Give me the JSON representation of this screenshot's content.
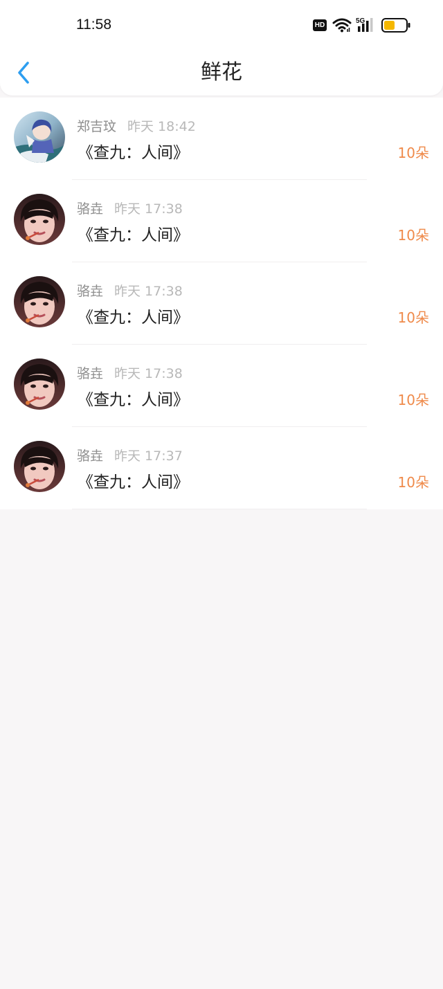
{
  "status_bar": {
    "time": "11:58",
    "hd_label": "HD",
    "network_label": "5G",
    "battery_level": 0.5,
    "battery_color": "#f5b800",
    "icons": [
      "hd-icon",
      "wifi-icon",
      "signal-icon",
      "battery-icon"
    ]
  },
  "header": {
    "title": "鲜花",
    "back_icon": "chevron-left-icon",
    "accent_color": "#2d9ef0"
  },
  "records": [
    {
      "name": "郑吉玟",
      "time": "昨天 18:42",
      "work": "《查九：人间》",
      "amount": "10朵",
      "avatar": "anime-avatar"
    },
    {
      "name": "骆垚",
      "time": "昨天 17:38",
      "work": "《查九：人间》",
      "amount": "10朵",
      "avatar": "portrait-avatar"
    },
    {
      "name": "骆垚",
      "time": "昨天 17:38",
      "work": "《查九：人间》",
      "amount": "10朵",
      "avatar": "portrait-avatar"
    },
    {
      "name": "骆垚",
      "time": "昨天 17:38",
      "work": "《查九：人间》",
      "amount": "10朵",
      "avatar": "portrait-avatar"
    },
    {
      "name": "骆垚",
      "time": "昨天 17:37",
      "work": "《查九：人间》",
      "amount": "10朵",
      "avatar": "portrait-avatar"
    }
  ],
  "colors": {
    "amount": "#ef8a4a",
    "background": "#f8f6f7"
  }
}
